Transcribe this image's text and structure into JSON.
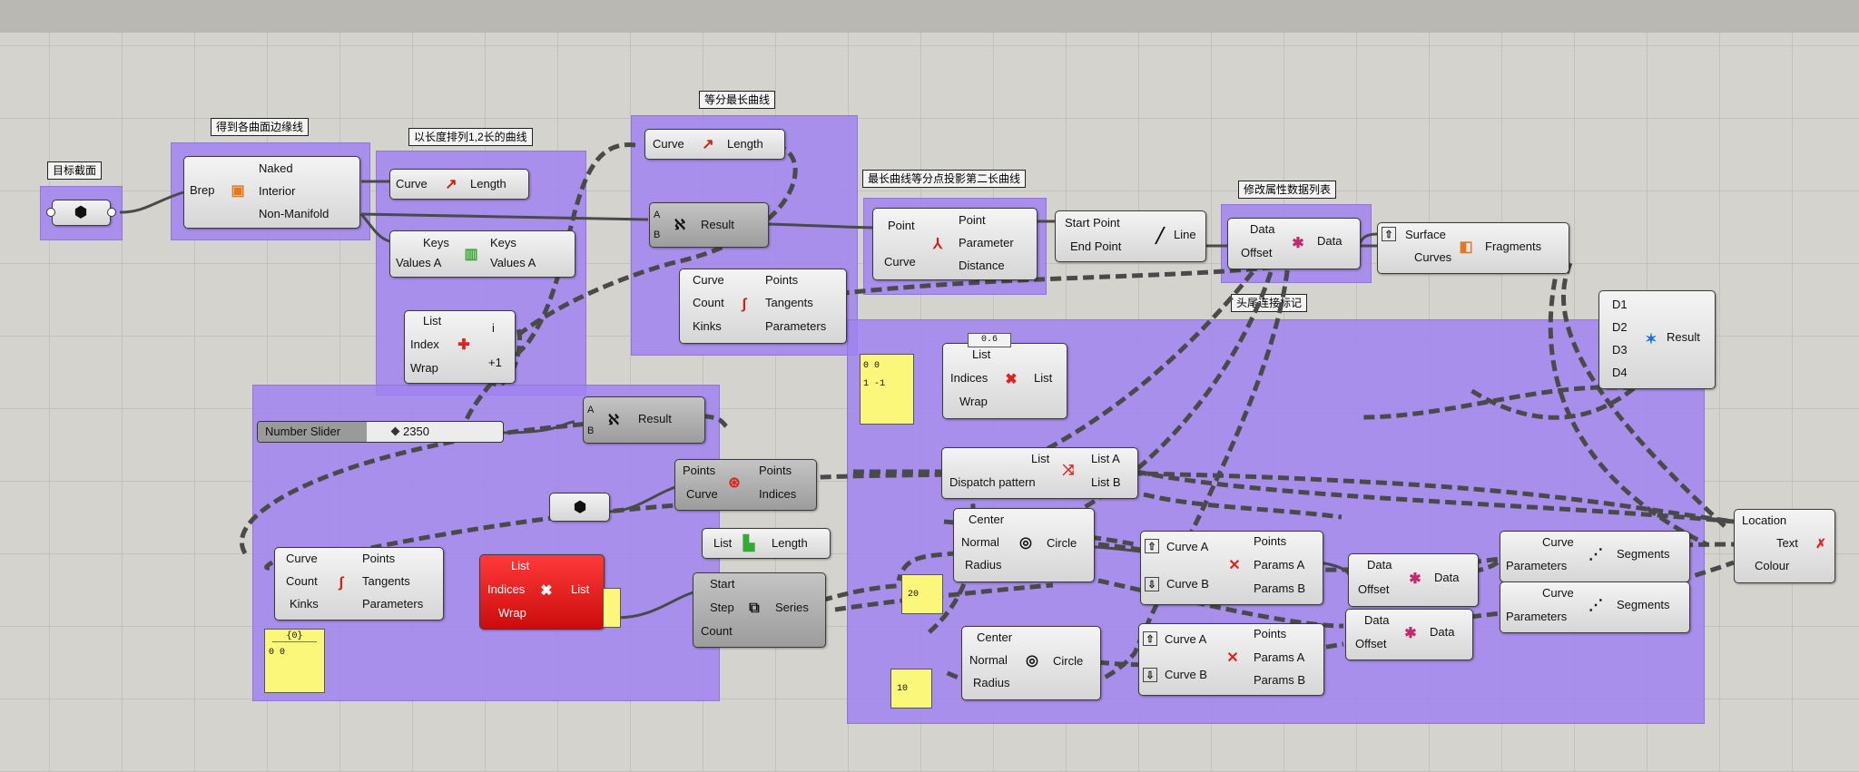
{
  "groups": {
    "g1": "目标截面",
    "g2": "得到各曲面边缘线",
    "g3": "以长度排列1,2长的曲线",
    "g4": "等分最长曲线",
    "g5": "最长曲线等分点投影第二长曲线",
    "g6": "修改属性数据列表",
    "g7": "头尾连接标记"
  },
  "nodes": {
    "brep": {
      "in": [
        "Brep"
      ],
      "out": [
        "Naked",
        "Interior",
        "Non-Manifold"
      ]
    },
    "length1": {
      "in": [
        "Curve"
      ],
      "out": [
        "Length"
      ]
    },
    "sort": {
      "in": [
        "Keys",
        "Values A"
      ],
      "out": [
        "Keys",
        "Values A"
      ]
    },
    "listitem": {
      "in": [
        "List",
        "Index",
        "Wrap"
      ],
      "out": [
        "i",
        "+1"
      ]
    },
    "length2": {
      "in": [
        "Curve"
      ],
      "out": [
        "Length"
      ]
    },
    "eq1": {
      "in": [
        "A",
        "B"
      ],
      "out": [
        "Result"
      ]
    },
    "divide1": {
      "in": [
        "Curve",
        "Count",
        "Kinks"
      ],
      "out": [
        "Points",
        "Tangents",
        "Parameters"
      ]
    },
    "eq2": {
      "in": [
        "A",
        "B"
      ],
      "out": [
        "Result"
      ]
    },
    "cp": {
      "in": [
        "Point",
        "Curve"
      ],
      "out": [
        "Point",
        "Parameter",
        "Distance"
      ]
    },
    "line": {
      "in": [
        "Start Point",
        "End Point"
      ],
      "out": [
        "Line"
      ]
    },
    "shift1": {
      "in": [
        "Data",
        "Offset"
      ],
      "out": [
        "Data"
      ]
    },
    "split": {
      "in": [
        "Surface",
        "Curves"
      ],
      "out": [
        "Fragments"
      ]
    },
    "merge": {
      "in": [
        "D1",
        "D2",
        "D3",
        "D4"
      ],
      "out": [
        "Result"
      ]
    },
    "cull": {
      "in": [
        "List",
        "Indices",
        "Wrap"
      ],
      "out": [
        "List"
      ]
    },
    "dispatch": {
      "in": [
        "List",
        "Dispatch pattern"
      ],
      "out": [
        "List A",
        "List B"
      ]
    },
    "circle1": {
      "in": [
        "Center",
        "Normal",
        "Radius"
      ],
      "out": [
        "Circle"
      ]
    },
    "ccx1": {
      "in": [
        "Curve A",
        "Curve B"
      ],
      "out": [
        "Points",
        "Params A",
        "Params B"
      ]
    },
    "shift2": {
      "in": [
        "Data",
        "Offset"
      ],
      "out": [
        "Data"
      ]
    },
    "shatter1": {
      "in": [
        "Curve",
        "Parameters"
      ],
      "out": [
        "Segments"
      ]
    },
    "shatter2": {
      "in": [
        "Curve",
        "Parameters"
      ],
      "out": [
        "Segments"
      ]
    },
    "tag": {
      "in": [
        "Location",
        "Text",
        "Colour"
      ],
      "out": []
    },
    "sortpts": {
      "in": [
        "Points",
        "Curve"
      ],
      "out": [
        "Points",
        "Indices"
      ]
    },
    "listlen": {
      "in": [
        "List"
      ],
      "out": [
        "Length"
      ]
    },
    "divide2": {
      "in": [
        "Curve",
        "Count",
        "Kinks"
      ],
      "out": [
        "Points",
        "Tangents",
        "Parameters"
      ]
    },
    "cullred": {
      "in": [
        "List",
        "Indices",
        "Wrap"
      ],
      "out": [
        "List"
      ]
    },
    "series": {
      "in": [
        "Start",
        "Step",
        "Count"
      ],
      "out": [
        "Series"
      ]
    },
    "circle2": {
      "in": [
        "Center",
        "Normal",
        "Radius"
      ],
      "out": [
        "Circle"
      ]
    },
    "ccx2": {
      "in": [
        "Curve A",
        "Curve B"
      ],
      "out": [
        "Points",
        "Params A",
        "Params B"
      ]
    },
    "shift3": {
      "in": [
        "Data",
        "Offset"
      ],
      "out": [
        "Data"
      ]
    }
  },
  "slider": {
    "label": "Number Slider",
    "value": "2350"
  },
  "panels": {
    "p1": "0 0\n1 -1",
    "p2": "0.6",
    "p3": "20",
    "p4": "10",
    "p5_head": "{0}",
    "p5_body": "0 0"
  },
  "colors": {
    "group": "#a082f0",
    "canvas": "#d4d3cd",
    "wire": "#4a4a4a",
    "red_node": "#e01818",
    "panel": "#fbf77a"
  },
  "icons": {
    "brep": "box-icon",
    "length": "curve-length-icon",
    "sort": "sort-list-icon",
    "listitem": "list-item-icon",
    "equality": "equality-icon",
    "divide": "divide-curve-icon",
    "cp": "curve-closest-point-icon",
    "line": "line-icon",
    "shift": "shift-list-icon",
    "split": "split-surface-icon",
    "merge": "merge-icon",
    "cull": "cull-index-icon",
    "dispatch": "dispatch-icon",
    "circle": "circle-icon",
    "ccx": "curve-intersect-icon",
    "shatter": "shatter-icon",
    "tag": "text-tag-icon",
    "sortpts": "sort-points-icon",
    "listlen": "list-length-icon",
    "series": "series-icon"
  }
}
